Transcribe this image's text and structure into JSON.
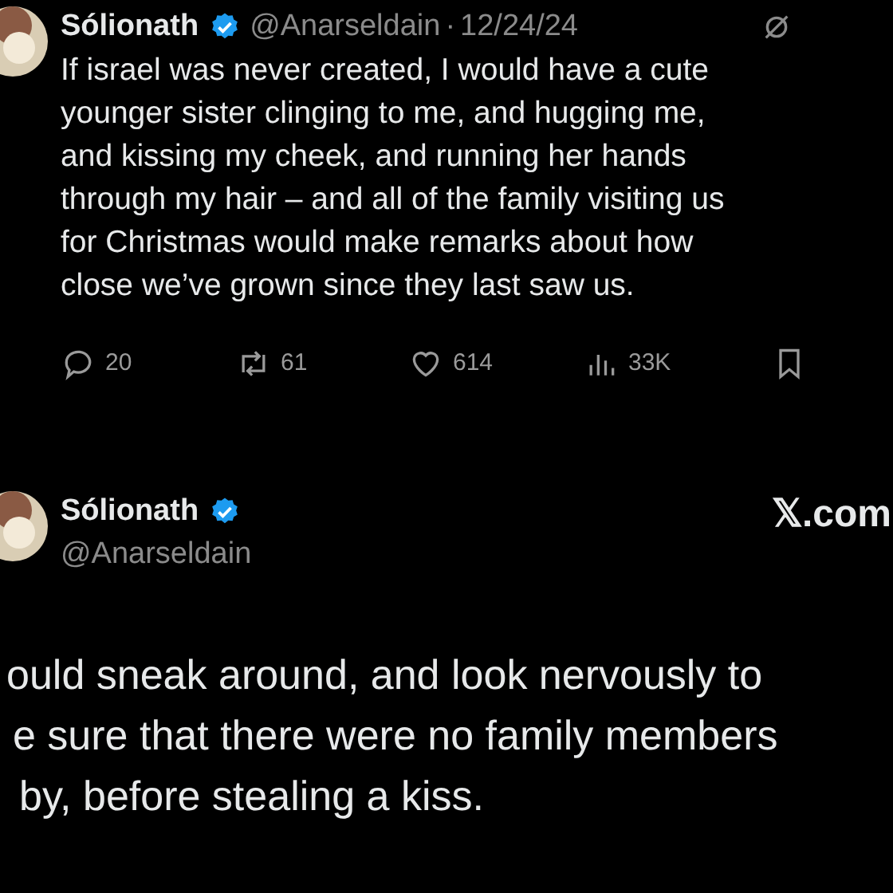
{
  "tweet": {
    "name": "Sólionath",
    "verified": true,
    "handle": "@Anarseldain",
    "separator": "·",
    "date": "12/24/24",
    "body_lines": [
      "If israel was never created, I would have a cute",
      "younger sister clinging to me, and hugging me,",
      "and kissing my cheek, and running her hands",
      "through my hair – and all of the family visiting us",
      "for Christmas would make remarks about how",
      "close we’ve grown since they last saw us."
    ],
    "actions": [
      {
        "kind": "reply",
        "count": "20"
      },
      {
        "kind": "repost",
        "count": "61"
      },
      {
        "kind": "like",
        "count": "614"
      },
      {
        "kind": "views",
        "count": "33K"
      },
      {
        "kind": "bookmark"
      }
    ]
  },
  "quoted": {
    "name": "Sólionath",
    "verified": true,
    "handle": "@Anarseldain",
    "site": "𝕏.com",
    "body_lines": [
      "ould sneak around, and look nervously to",
      "e sure that there were no family members",
      "by, before stealing a kiss."
    ]
  }
}
